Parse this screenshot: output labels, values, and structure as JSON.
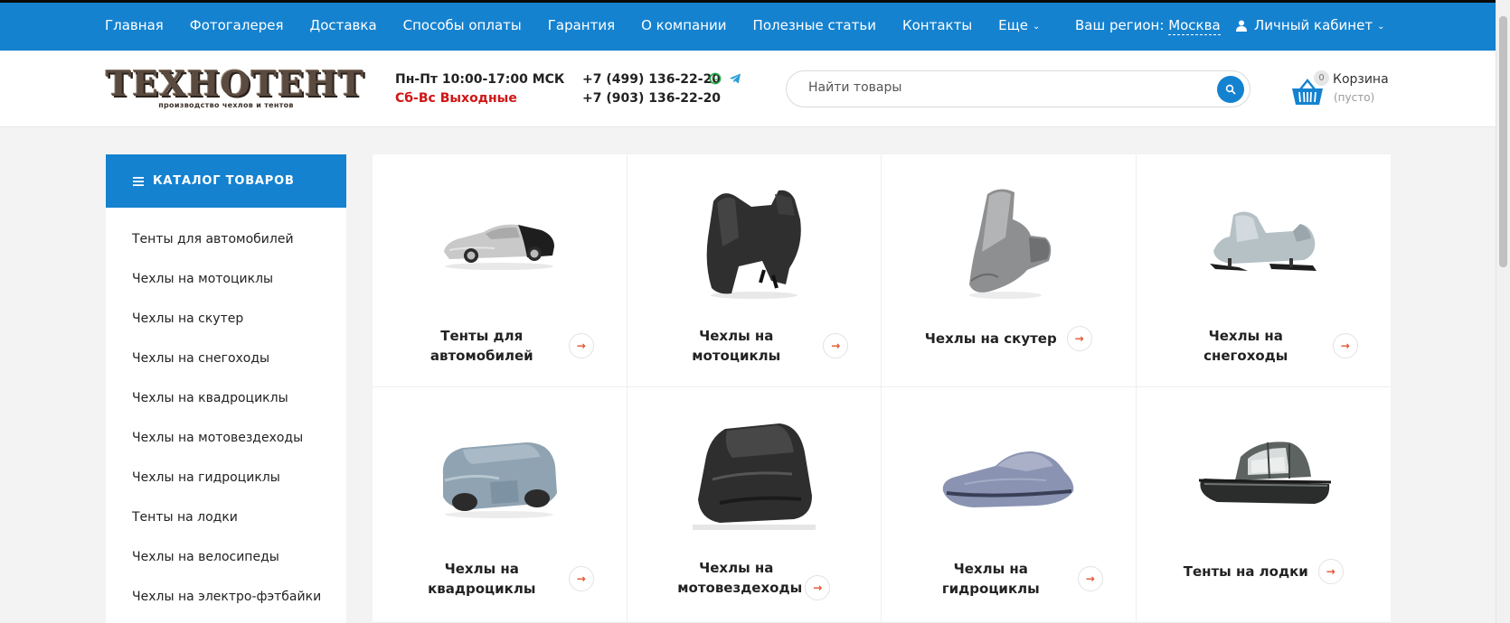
{
  "topnav": {
    "items": [
      {
        "label": "Главная"
      },
      {
        "label": "Фотогалерея"
      },
      {
        "label": "Доставка"
      },
      {
        "label": "Способы оплаты"
      },
      {
        "label": "Гарантия"
      },
      {
        "label": "О компании"
      },
      {
        "label": "Полезные статьи"
      },
      {
        "label": "Контакты"
      },
      {
        "label": "Еще"
      }
    ],
    "region_label": "Ваш регион:",
    "region_city": "Москва",
    "account_label": "Личный кабинет"
  },
  "header": {
    "logo_text": "ТЕХНОТЕНТ",
    "logo_subtitle": "производство чехлов и тентов",
    "hours_weekdays": "Пн-Пт 10:00-17:00 МСК",
    "hours_weekend": "Сб-Вс Выходные",
    "phone_1": "+7 (499) 136-22-20",
    "phone_2": "+7 (903) 136-22-20",
    "search_placeholder": "Найти товары",
    "cart_count": "0",
    "cart_label": "Корзина",
    "cart_status": "(пусто)"
  },
  "catalog": {
    "title": "КАТАЛОГ ТОВАРОВ",
    "items": [
      {
        "label": "Тенты для автомобилей"
      },
      {
        "label": "Чехлы на мотоциклы"
      },
      {
        "label": "Чехлы на скутер"
      },
      {
        "label": "Чехлы на снегоходы"
      },
      {
        "label": "Чехлы на квадроциклы"
      },
      {
        "label": "Чехлы на мотовездеходы"
      },
      {
        "label": "Чехлы на гидроциклы"
      },
      {
        "label": "Тенты на лодки"
      },
      {
        "label": "Чехлы на велосипеды"
      },
      {
        "label": "Чехлы на электро-фэтбайки"
      }
    ]
  },
  "categories": [
    {
      "label": "Тенты для автомобилей",
      "icon": "car-cover-image"
    },
    {
      "label": "Чехлы на мотоциклы",
      "icon": "motorcycle-cover-image"
    },
    {
      "label": "Чехлы на скутер",
      "icon": "scooter-cover-image"
    },
    {
      "label": "Чехлы на снегоходы",
      "icon": "snowmobile-cover-image"
    },
    {
      "label": "Чехлы на квадроциклы",
      "icon": "atv-cover-image"
    },
    {
      "label": "Чехлы на мотовездеходы",
      "icon": "utv-cover-image"
    },
    {
      "label": "Чехлы на гидроциклы",
      "icon": "jetski-cover-image"
    },
    {
      "label": "Тенты на лодки",
      "icon": "boat-tent-image"
    }
  ],
  "colors": {
    "brand_blue": "#1582d0",
    "weekend_red": "#d01515",
    "arrow_orange": "#e5532e"
  }
}
